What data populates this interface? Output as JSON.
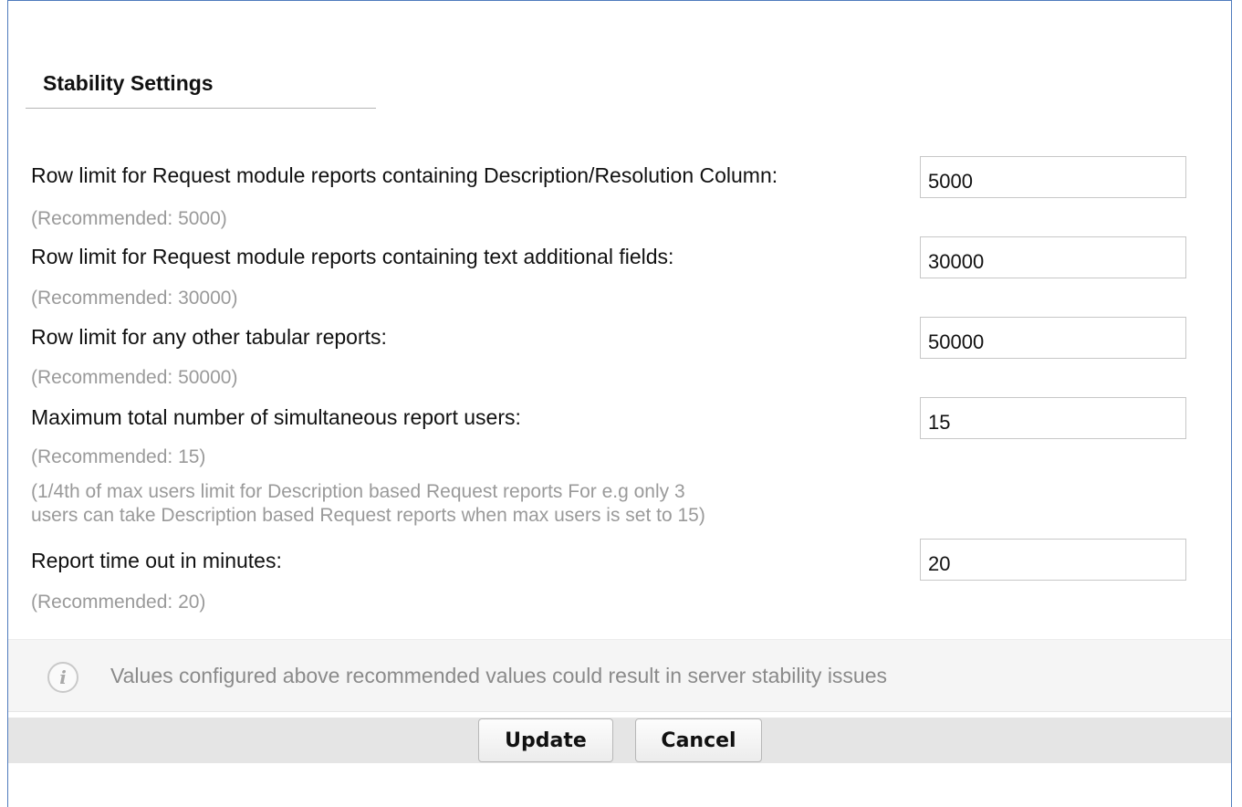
{
  "section": {
    "title": "Stability Settings"
  },
  "settings": [
    {
      "label": "Row limit for Request module reports containing Description/Resolution Column:",
      "value": "5000",
      "hint": "(Recommended: 5000)"
    },
    {
      "label": "Row limit for Request module reports containing text additional fields:",
      "value": "30000",
      "hint": "(Recommended: 30000)"
    },
    {
      "label": "Row limit for any other tabular reports:",
      "value": "50000",
      "hint": "(Recommended: 50000)"
    },
    {
      "label": "Maximum total number of simultaneous report users:",
      "value": "15",
      "hint": "(Recommended: 15)",
      "note_line1": "(1/4th of max users limit for Description based Request reports For e.g only 3",
      "note_line2": "users can take Description based Request reports when max users is set to 15)"
    },
    {
      "label": "Report time out in minutes:",
      "value": "20",
      "hint": "(Recommended: 20)"
    }
  ],
  "info": {
    "icon": "info-icon",
    "glyph": "i",
    "text": "Values configured above recommended values could result in server stability issues"
  },
  "actions": {
    "update_label": "Update",
    "cancel_label": "Cancel"
  }
}
